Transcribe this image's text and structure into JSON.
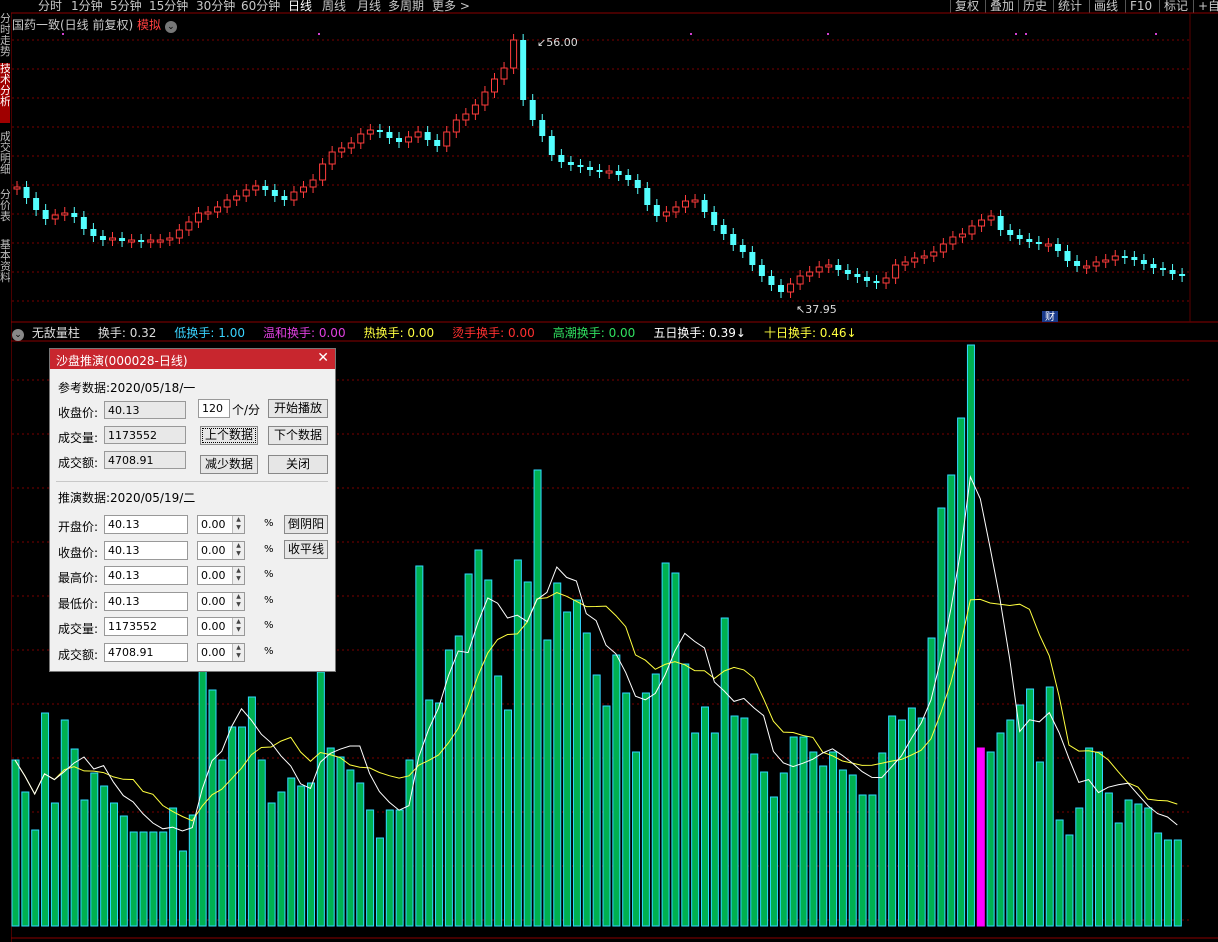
{
  "toolbar": {
    "periods": [
      "分时",
      "1分钟",
      "5分钟",
      "15分钟",
      "30分钟",
      "60分钟",
      "日线",
      "周线",
      "月线",
      "多周期",
      "更多 >"
    ],
    "active_period": "日线",
    "right_buttons": [
      "复权",
      "叠加",
      "历史",
      "统计",
      "画线",
      "F10",
      "标记",
      "+自选"
    ]
  },
  "left_tabs": [
    "分时走势",
    "技术分析",
    "成交明细",
    "分价表",
    "基本资料"
  ],
  "chart_title": {
    "text": "国药一致(日线 前复权)",
    "sim": "模拟"
  },
  "price_labels": {
    "high": "56.00",
    "low": "37.95",
    "fin_badge": "财"
  },
  "volume_header": [
    {
      "text": "无敌量柱",
      "color": "#dddddd"
    },
    {
      "text": "换手: 0.32",
      "color": "#dddddd"
    },
    {
      "text": "低换手: 1.00",
      "color": "#39d4ff"
    },
    {
      "text": "温和换手: 0.00",
      "color": "#e040e0"
    },
    {
      "text": "热换手: 0.00",
      "color": "#ffff40"
    },
    {
      "text": "烫手换手: 0.00",
      "color": "#ff3030"
    },
    {
      "text": "高潮换手: 0.00",
      "color": "#30e060"
    },
    {
      "text": "五日换手: 0.39↓",
      "color": "#ffffff"
    },
    {
      "text": "十日换手: 0.46↓",
      "color": "#ffff40"
    }
  ],
  "dialog": {
    "title": "沙盘推演(000028-日线)",
    "close": "✕",
    "ref_label": "参考数据:2020/05/18/一",
    "ref_rows": [
      {
        "label": "收盘价:",
        "value": "40.13"
      },
      {
        "label": "成交量:",
        "value": "1173552"
      },
      {
        "label": "成交额:",
        "value": "4708.91"
      }
    ],
    "speed_value": "120",
    "speed_unit": "个/分",
    "buttons": {
      "play": "开始播放",
      "prev": "上个数据",
      "next": "下个数据",
      "reduce": "减少数据",
      "close": "关闭",
      "invert": "倒阴阳",
      "flat": "收平线"
    },
    "sim_label": "推演数据:2020/05/19/二",
    "sim_rows": [
      {
        "label": "开盘价:",
        "value": "40.13",
        "pct": "0.00",
        "unit": "%"
      },
      {
        "label": "收盘价:",
        "value": "40.13",
        "pct": "0.00",
        "unit": "%"
      },
      {
        "label": "最高价:",
        "value": "40.13",
        "pct": "0.00",
        "unit": "%"
      },
      {
        "label": "最低价:",
        "value": "40.13",
        "pct": "0.00",
        "unit": "%"
      },
      {
        "label": "成交量:",
        "value": "1173552",
        "pct": "0.00",
        "unit": "%"
      },
      {
        "label": "成交额:",
        "value": "4708.91",
        "pct": "0.00",
        "unit": "%"
      }
    ]
  },
  "colors": {
    "up": "#ff3d3d",
    "down": "#54ffff",
    "vol_fill": "#00b050",
    "vol_edge": "#30d8ff",
    "highlight": "#ff00ff",
    "ma5": "#ffffff",
    "ma10": "#ffff40",
    "grid": "#7a0000"
  }
}
